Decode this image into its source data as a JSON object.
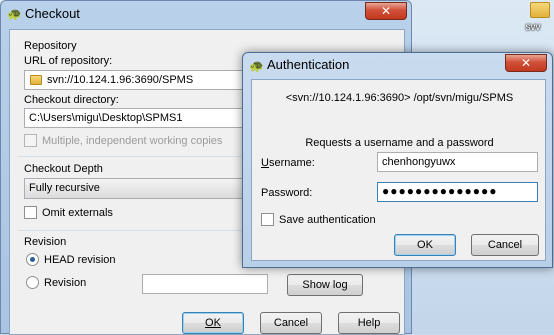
{
  "desktop": {
    "icon_label": "svv"
  },
  "checkout": {
    "title": "Checkout",
    "repository_group": "Repository",
    "url_label": "URL of repository:",
    "url_value": "svn://10.124.1.96:3690/SPMS",
    "dir_label": "Checkout directory:",
    "dir_value": "C:\\Users\\migu\\Desktop\\SPMS1",
    "multiple_label": "Multiple, independent working copies",
    "depth_group": "Checkout Depth",
    "depth_value": "Fully recursive",
    "omit_label": "Omit externals",
    "revision_group": "Revision",
    "head_label": "HEAD revision",
    "revision_label": "Revision",
    "revision_value": "",
    "show_log": "Show log",
    "ok": "OK",
    "cancel": "Cancel",
    "help": "Help"
  },
  "auth": {
    "title": "Authentication",
    "realm": "<svn://10.124.1.96:3690> /opt/svn/migu/SPMS",
    "prompt": "Requests a username and a password",
    "username_label": "Username:",
    "username_value": "chenhongyuwx",
    "password_label": "Password:",
    "password_value": "●●●●●●●●●●●●●●",
    "save_label": "Save authentication",
    "ok": "OK",
    "cancel": "Cancel",
    "hidden_button": "Show log"
  }
}
